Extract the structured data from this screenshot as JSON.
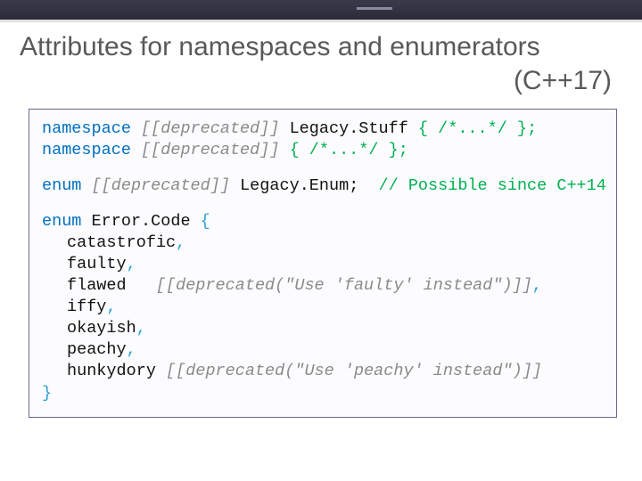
{
  "title": {
    "line1": "Attributes for namespaces and enumerators",
    "line2": "(C++17)"
  },
  "code": {
    "kw_namespace": "namespace",
    "kw_enum": "enum",
    "attr_dep": "[[deprecated]]",
    "ns1_name": "Legacy.Stuff",
    "ns1_body": " { /*...*/ };",
    "ns2_body": " { /*...*/ };",
    "enum1_name": "Legacy.Enum",
    "enum1_cmt": "// Possible since C++14",
    "enum2_name": "Error.Code",
    "open": " {",
    "close": "}",
    "e0": "catastrofic",
    "e1": "faulty",
    "e2": "flawed   ",
    "e2_attr": "[[deprecated(\"Use 'faulty' instead\")]]",
    "e3": "iffy",
    "e4": "okayish",
    "e5": "peachy",
    "e6": "hunkydory",
    "e6_attr": "[[deprecated(\"Use 'peachy' instead\")]]",
    "comma": ","
  }
}
